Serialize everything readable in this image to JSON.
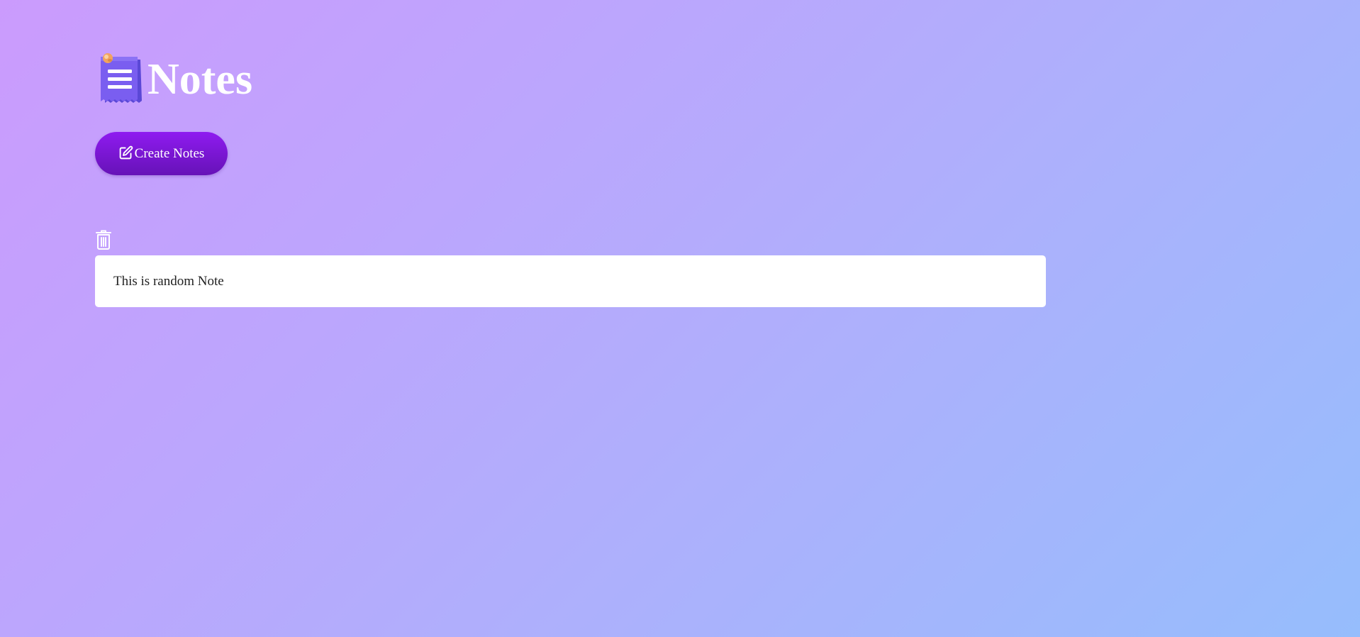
{
  "header": {
    "title": "Notes",
    "logo_icon": "notes-logo-icon"
  },
  "toolbar": {
    "create_label": "Create Notes",
    "create_icon": "edit-icon"
  },
  "notes": [
    {
      "text": "This is random Note",
      "delete_icon": "trash-icon"
    }
  ],
  "colors": {
    "background_start": "#cb9bfd",
    "background_end": "#96bdfc",
    "button_top": "#8f1bf0",
    "button_bottom": "#6612b7",
    "card": "#ffffff",
    "title": "#ffffff"
  }
}
